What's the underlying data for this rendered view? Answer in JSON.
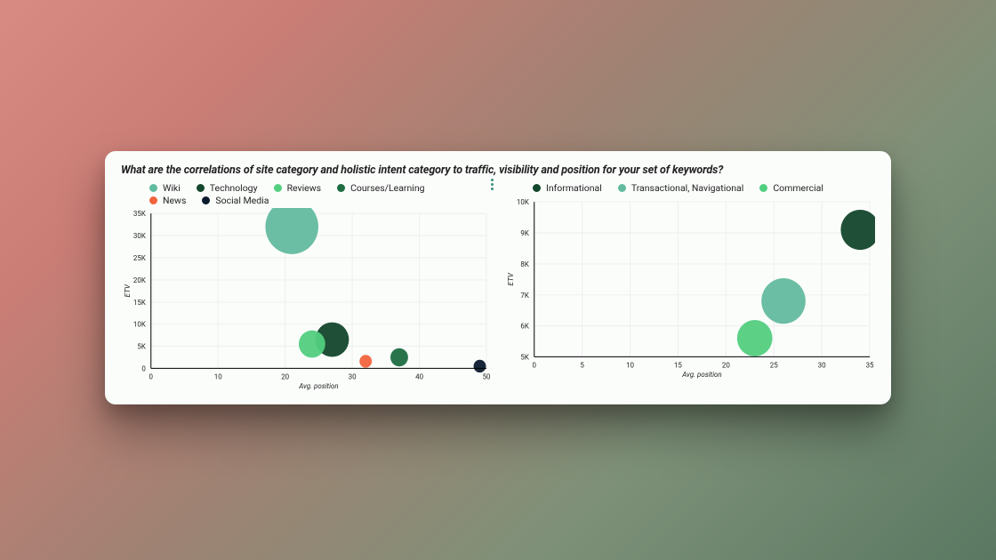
{
  "title": "What are the correlations of site category and holistic intent category to traffic, visibility and position for your set of keywords?",
  "chart_data": [
    {
      "type": "scatter",
      "subtype": "bubble",
      "title": "",
      "xlabel": "Avg. position",
      "ylabel": "ETV",
      "xlim": [
        0,
        50
      ],
      "ylim": [
        0,
        35000
      ],
      "xticks": [
        0,
        10,
        20,
        30,
        40,
        50
      ],
      "ytick_labels": [
        "0",
        "5K",
        "10K",
        "15K",
        "20K",
        "25K",
        "30K",
        "35K"
      ],
      "yticks": [
        0,
        5000,
        10000,
        15000,
        20000,
        25000,
        30000,
        35000
      ],
      "series": [
        {
          "name": "Wiki",
          "color": "#63bb9f",
          "x": 21,
          "y": 32000,
          "size": 60
        },
        {
          "name": "Technology",
          "color": "#13472c",
          "x": 27,
          "y": 6500,
          "size": 38
        },
        {
          "name": "Reviews",
          "color": "#53cf80",
          "x": 24,
          "y": 5500,
          "size": 30
        },
        {
          "name": "Courses/Learning",
          "color": "#1f6d42",
          "x": 37,
          "y": 2500,
          "size": 20
        },
        {
          "name": "News",
          "color": "#f1643d",
          "x": 32,
          "y": 1600,
          "size": 14
        },
        {
          "name": "Social Media",
          "color": "#0b1b2e",
          "x": 49,
          "y": 500,
          "size": 14
        }
      ]
    },
    {
      "type": "scatter",
      "subtype": "bubble",
      "title": "",
      "xlabel": "Avg. position",
      "ylabel": "ETV",
      "xlim": [
        0,
        35
      ],
      "ylim": [
        5000,
        10000
      ],
      "xticks": [
        0,
        5,
        10,
        15,
        20,
        25,
        30,
        35
      ],
      "ytick_labels": [
        "5K",
        "6K",
        "7K",
        "8K",
        "9K",
        "10K"
      ],
      "yticks": [
        5000,
        6000,
        7000,
        8000,
        9000,
        10000
      ],
      "series": [
        {
          "name": "Informational",
          "color": "#13472c",
          "x": 34,
          "y": 9100,
          "size": 44
        },
        {
          "name": "Transactional, Navigational",
          "color": "#63bb9f",
          "x": 26,
          "y": 6800,
          "size": 50
        },
        {
          "name": "Commercial",
          "color": "#53cf80",
          "x": 23,
          "y": 5600,
          "size": 40
        }
      ]
    }
  ]
}
